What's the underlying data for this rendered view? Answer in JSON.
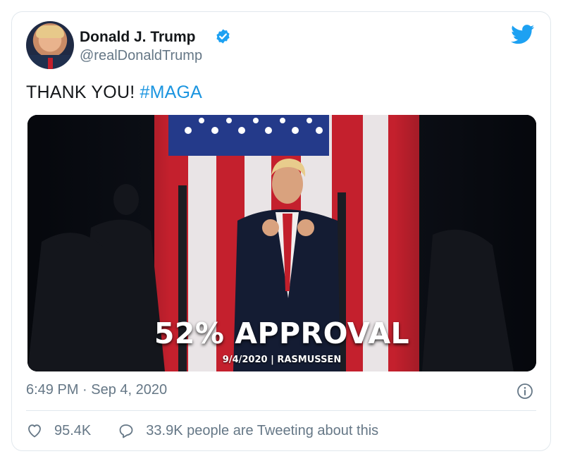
{
  "tweet": {
    "author_name": "Donald J. Trump",
    "author_handle": "@realDonaldTrump",
    "verified": true,
    "text": "THANK YOU! ",
    "hashtag": "#MAGA",
    "timestamp": "6:49 PM · Sep 4, 2020",
    "likes": "95.4K",
    "conversation": "33.9K people are Tweeting about this"
  },
  "media": {
    "headline": "52% APPROVAL",
    "subline": "9/4/2020 | RASMUSSEN"
  },
  "icons": {
    "brand": "twitter-bird-icon",
    "verified": "verified-badge-icon",
    "info": "info-icon",
    "like": "heart-icon",
    "reply": "reply-bubble-icon"
  },
  "colors": {
    "brand_blue": "#1da1f2",
    "hashtag": "#1b95e0",
    "muted": "#657786",
    "border": "#e1e8ed"
  }
}
